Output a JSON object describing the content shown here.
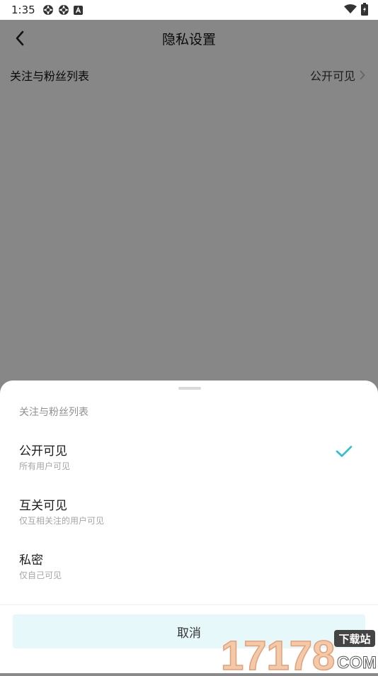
{
  "status_bar": {
    "time": "1:35",
    "icons": [
      "camera-shutter-icon",
      "camera-shutter-icon",
      "app-a-icon"
    ],
    "right_icons": [
      "wifi-icon",
      "battery-charging-icon"
    ]
  },
  "page": {
    "title": "隐私设置",
    "setting_row": {
      "label": "关注与粉丝列表",
      "value": "公开可见"
    }
  },
  "sheet": {
    "title": "关注与粉丝列表",
    "options": [
      {
        "title": "公开可见",
        "desc": "所有用户可见",
        "selected": true
      },
      {
        "title": "互关可见",
        "desc": "仅互相关注的用户可见",
        "selected": false
      },
      {
        "title": "私密",
        "desc": "仅自己可见",
        "selected": false
      }
    ],
    "cancel_label": "取消"
  },
  "watermark": {
    "number": "17178",
    "tag": "下载站",
    "domain": "COM"
  },
  "colors": {
    "accent": "#2bbfcf",
    "cancel_bg": "#e7f8fa",
    "overlay": "#8a8a8a"
  }
}
